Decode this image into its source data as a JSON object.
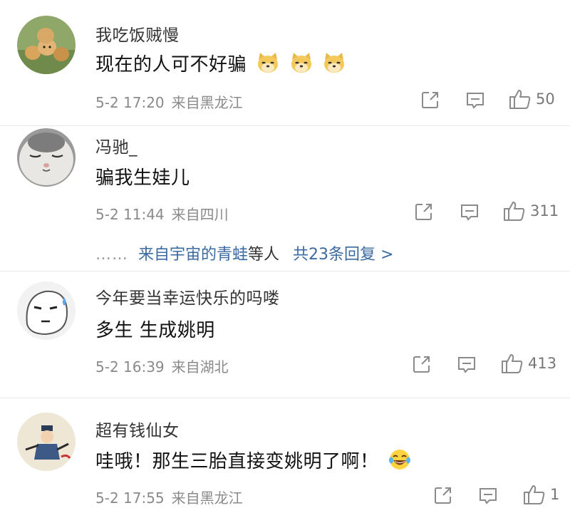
{
  "comments": [
    {
      "username": "我吃饭贼慢",
      "text": "现在的人可不好骗",
      "date": "5-2 17:20",
      "location": "来自黑龙江",
      "likes": "50",
      "emoji": "doge-emoji"
    },
    {
      "username": "冯驰_",
      "text": "骗我生娃儿",
      "date": "5-2 11:44",
      "location": "来自四川",
      "likes": "311",
      "replies": {
        "dots": "……",
        "link": "来自宇宙的青蛙",
        "suffix": "等人",
        "count": "共23条回复 >"
      }
    },
    {
      "username": "今年要当幸运快乐的吗喽",
      "text": "多生 生成姚明",
      "date": "5-2 16:39",
      "location": "来自湖北",
      "likes": "413"
    },
    {
      "username": "超有钱仙女",
      "text": "哇哦！那生三胎直接变姚明了啊！",
      "date": "5-2 17:55",
      "location": "来自黑龙江",
      "likes": "1",
      "emoji": "laugh-cry-emoji"
    }
  ],
  "icons": {
    "share": "share-icon",
    "comment": "comment-icon",
    "like": "thumbs-up-icon"
  },
  "colors": {
    "link": "#3b6aa0",
    "meta": "#8a8a8a",
    "divider": "#e8e8e8"
  }
}
